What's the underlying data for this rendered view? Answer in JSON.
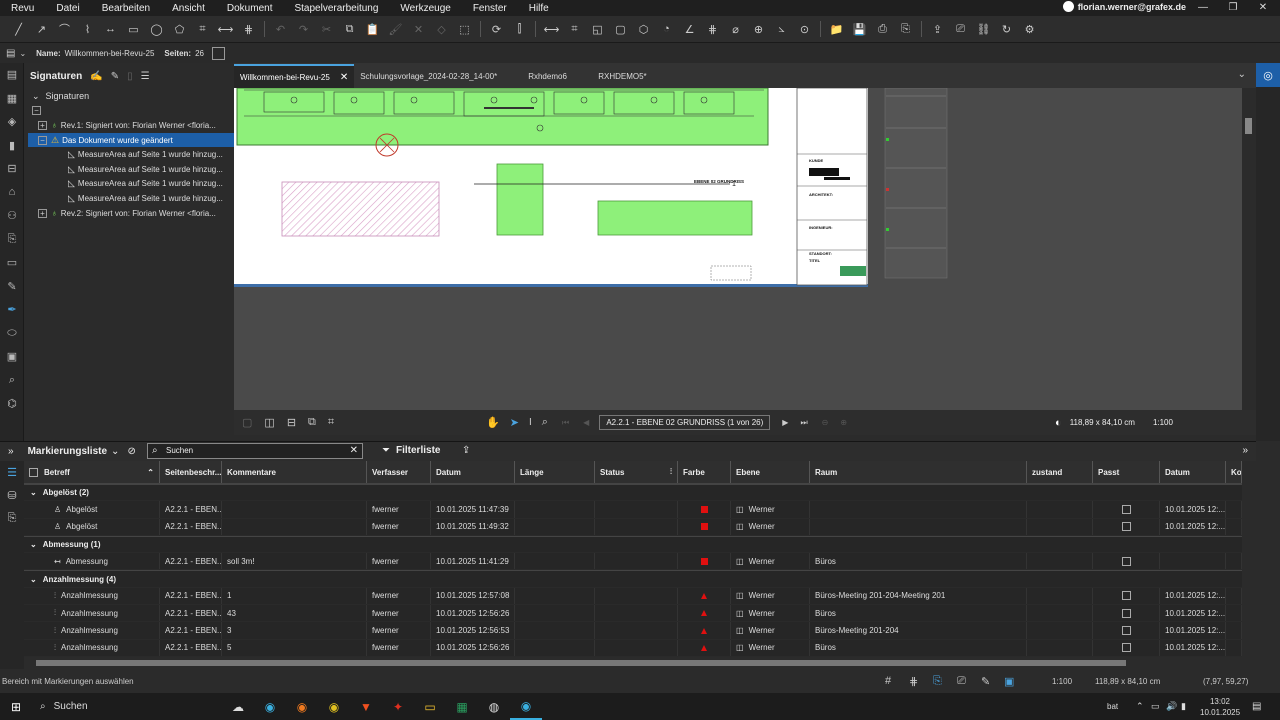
{
  "menu": [
    "Revu",
    "Datei",
    "Bearbeiten",
    "Ansicht",
    "Dokument",
    "Stapelverarbeitung",
    "Werkzeuge",
    "Fenster",
    "Hilfe"
  ],
  "user": "florian.werner@grafex.de",
  "docbar": {
    "name_label": "Name:",
    "name": "Willkommen-bei-Revu-25",
    "pages_label": "Seiten:",
    "pages": "26"
  },
  "sig": {
    "title": "Signaturen",
    "root": "Signaturen",
    "rows": [
      {
        "text": "Rev.1: Signiert von: Florian Werner <floria...",
        "level": 1,
        "exp": "+",
        "icon": "sig"
      },
      {
        "text": "Das Dokument wurde geändert",
        "level": 1,
        "exp": "−",
        "icon": "warn",
        "sel": true
      },
      {
        "text": "MeasureArea auf Seite 1 wurde hinzug...",
        "level": 2,
        "icon": "area"
      },
      {
        "text": "MeasureArea auf Seite 1 wurde hinzug...",
        "level": 2,
        "icon": "area"
      },
      {
        "text": "MeasureArea auf Seite 1 wurde hinzug...",
        "level": 2,
        "icon": "area"
      },
      {
        "text": "MeasureArea auf Seite 1 wurde hinzug...",
        "level": 2,
        "icon": "area"
      },
      {
        "text": "Rev.2: Signiert von: Florian Werner <floria...",
        "level": 1,
        "exp": "+",
        "icon": "sig"
      }
    ]
  },
  "tabs": [
    "Willkommen-bei-Revu-25",
    "Schulungsvorlage_2024-02-28_14-00*",
    "Rxhdemo6",
    "RXHDEMO5*"
  ],
  "drawing": {
    "label": "EBENE 02 GRUNDRISS",
    "num": "1",
    "tb": {
      "kunde": "KUNDE",
      "architekt": "ARCHITEKT:",
      "ingenieur": "INGENIEUR:",
      "standort": "STANDORT:",
      "titel": "TITEL"
    }
  },
  "nav": {
    "page": "A2.2.1 - EBENE 02 GRUNDRISS (1 von 26)",
    "size": "118,89 x 84,10 cm",
    "scale": "1:100"
  },
  "markup": {
    "title": "Markierungsliste",
    "search_placeholder": "Suchen",
    "filter": "Filterliste",
    "columns": [
      "Betreff",
      "Seitenbeschr...",
      "Kommentare",
      "Verfasser",
      "Datum",
      "Länge",
      "Status",
      "",
      "Farbe",
      "Ebene",
      "Raum",
      "zustand",
      "Passt",
      "Datum",
      "Ko"
    ],
    "groups": [
      {
        "label": "Abgelöst (2)",
        "rows": [
          {
            "subject": "Abgelöst",
            "page": "A2.2.1 - EBEN...",
            "comment": "",
            "author": "fwerner",
            "date": "10.01.2025 11:47:39",
            "color": "sq",
            "layer": "Werner",
            "room": "",
            "date2": "10.01.2025 12:..."
          },
          {
            "subject": "Abgelöst",
            "page": "A2.2.1 - EBEN...",
            "comment": "",
            "author": "fwerner",
            "date": "10.01.2025 11:49:32",
            "color": "sq",
            "layer": "Werner",
            "room": "",
            "date2": "10.01.2025 12:..."
          }
        ]
      },
      {
        "label": "Abmessung (1)",
        "rows": [
          {
            "subject": "Abmessung",
            "page": "A2.2.1 - EBEN...",
            "comment": "soll 3m!",
            "author": "fwerner",
            "date": "10.01.2025 11:41:29",
            "color": "sq",
            "layer": "Werner",
            "room": "Büros",
            "date2": ""
          }
        ]
      },
      {
        "label": "Anzahlmessung (4)",
        "rows": [
          {
            "subject": "Anzahlmessung",
            "page": "A2.2.1 - EBEN...",
            "comment": "1",
            "author": "fwerner",
            "date": "10.01.2025 12:57:08",
            "color": "tri",
            "layer": "Werner",
            "room": "Büros-Meeting 201-204-Meeting 201",
            "date2": "10.01.2025 12:..."
          },
          {
            "subject": "Anzahlmessung",
            "page": "A2.2.1 - EBEN...",
            "comment": "43",
            "author": "fwerner",
            "date": "10.01.2025 12:56:26",
            "color": "tri",
            "layer": "Werner",
            "room": "Büros",
            "date2": "10.01.2025 12:..."
          },
          {
            "subject": "Anzahlmessung",
            "page": "A2.2.1 - EBEN...",
            "comment": "3",
            "author": "fwerner",
            "date": "10.01.2025 12:56:53",
            "color": "tri",
            "layer": "Werner",
            "room": "Büros-Meeting 201-204",
            "date2": "10.01.2025 12:..."
          },
          {
            "subject": "Anzahlmessung",
            "page": "A2.2.1 - EBEN...",
            "comment": "5",
            "author": "fwerner",
            "date": "10.01.2025 12:56:26",
            "color": "tri",
            "layer": "Werner",
            "room": "Büros",
            "date2": "10.01.2025 12:..."
          }
        ]
      }
    ]
  },
  "status": {
    "hint": "Bereich mit Markierungen auswählen",
    "scale": "1:100",
    "size": "118,89 x 84,10 cm",
    "coords": "(7,97, 59,27)"
  },
  "taskbar": {
    "search": "Suchen",
    "lang": "bat",
    "time": "13:02",
    "date": "10.01.2025"
  },
  "colors": {
    "accent": "#4aa3df",
    "markup_green": "#8ef07a",
    "selection": "#1d5fa8",
    "red": "#e01010"
  }
}
